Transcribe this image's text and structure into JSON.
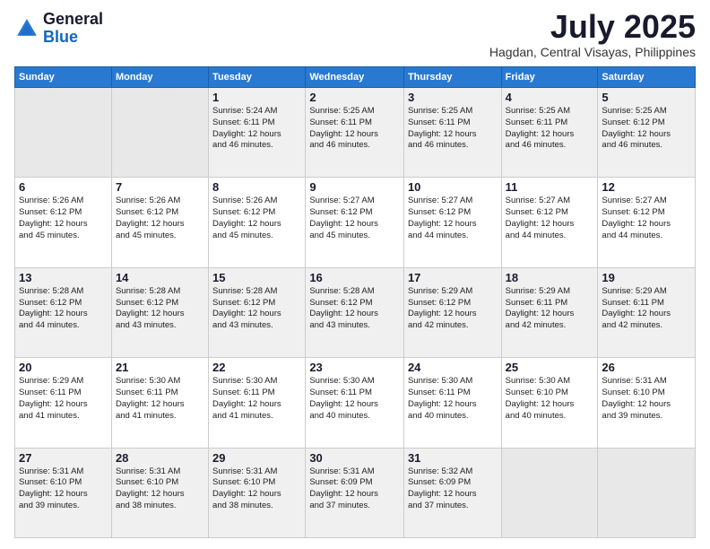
{
  "header": {
    "logo_general": "General",
    "logo_blue": "Blue",
    "month_title": "July 2025",
    "location": "Hagdan, Central Visayas, Philippines"
  },
  "days_of_week": [
    "Sunday",
    "Monday",
    "Tuesday",
    "Wednesday",
    "Thursday",
    "Friday",
    "Saturday"
  ],
  "weeks": [
    [
      {
        "day": "",
        "detail": ""
      },
      {
        "day": "",
        "detail": ""
      },
      {
        "day": "1",
        "detail": "Sunrise: 5:24 AM\nSunset: 6:11 PM\nDaylight: 12 hours\nand 46 minutes."
      },
      {
        "day": "2",
        "detail": "Sunrise: 5:25 AM\nSunset: 6:11 PM\nDaylight: 12 hours\nand 46 minutes."
      },
      {
        "day": "3",
        "detail": "Sunrise: 5:25 AM\nSunset: 6:11 PM\nDaylight: 12 hours\nand 46 minutes."
      },
      {
        "day": "4",
        "detail": "Sunrise: 5:25 AM\nSunset: 6:11 PM\nDaylight: 12 hours\nand 46 minutes."
      },
      {
        "day": "5",
        "detail": "Sunrise: 5:25 AM\nSunset: 6:12 PM\nDaylight: 12 hours\nand 46 minutes."
      }
    ],
    [
      {
        "day": "6",
        "detail": "Sunrise: 5:26 AM\nSunset: 6:12 PM\nDaylight: 12 hours\nand 45 minutes."
      },
      {
        "day": "7",
        "detail": "Sunrise: 5:26 AM\nSunset: 6:12 PM\nDaylight: 12 hours\nand 45 minutes."
      },
      {
        "day": "8",
        "detail": "Sunrise: 5:26 AM\nSunset: 6:12 PM\nDaylight: 12 hours\nand 45 minutes."
      },
      {
        "day": "9",
        "detail": "Sunrise: 5:27 AM\nSunset: 6:12 PM\nDaylight: 12 hours\nand 45 minutes."
      },
      {
        "day": "10",
        "detail": "Sunrise: 5:27 AM\nSunset: 6:12 PM\nDaylight: 12 hours\nand 44 minutes."
      },
      {
        "day": "11",
        "detail": "Sunrise: 5:27 AM\nSunset: 6:12 PM\nDaylight: 12 hours\nand 44 minutes."
      },
      {
        "day": "12",
        "detail": "Sunrise: 5:27 AM\nSunset: 6:12 PM\nDaylight: 12 hours\nand 44 minutes."
      }
    ],
    [
      {
        "day": "13",
        "detail": "Sunrise: 5:28 AM\nSunset: 6:12 PM\nDaylight: 12 hours\nand 44 minutes."
      },
      {
        "day": "14",
        "detail": "Sunrise: 5:28 AM\nSunset: 6:12 PM\nDaylight: 12 hours\nand 43 minutes."
      },
      {
        "day": "15",
        "detail": "Sunrise: 5:28 AM\nSunset: 6:12 PM\nDaylight: 12 hours\nand 43 minutes."
      },
      {
        "day": "16",
        "detail": "Sunrise: 5:28 AM\nSunset: 6:12 PM\nDaylight: 12 hours\nand 43 minutes."
      },
      {
        "day": "17",
        "detail": "Sunrise: 5:29 AM\nSunset: 6:12 PM\nDaylight: 12 hours\nand 42 minutes."
      },
      {
        "day": "18",
        "detail": "Sunrise: 5:29 AM\nSunset: 6:11 PM\nDaylight: 12 hours\nand 42 minutes."
      },
      {
        "day": "19",
        "detail": "Sunrise: 5:29 AM\nSunset: 6:11 PM\nDaylight: 12 hours\nand 42 minutes."
      }
    ],
    [
      {
        "day": "20",
        "detail": "Sunrise: 5:29 AM\nSunset: 6:11 PM\nDaylight: 12 hours\nand 41 minutes."
      },
      {
        "day": "21",
        "detail": "Sunrise: 5:30 AM\nSunset: 6:11 PM\nDaylight: 12 hours\nand 41 minutes."
      },
      {
        "day": "22",
        "detail": "Sunrise: 5:30 AM\nSunset: 6:11 PM\nDaylight: 12 hours\nand 41 minutes."
      },
      {
        "day": "23",
        "detail": "Sunrise: 5:30 AM\nSunset: 6:11 PM\nDaylight: 12 hours\nand 40 minutes."
      },
      {
        "day": "24",
        "detail": "Sunrise: 5:30 AM\nSunset: 6:11 PM\nDaylight: 12 hours\nand 40 minutes."
      },
      {
        "day": "25",
        "detail": "Sunrise: 5:30 AM\nSunset: 6:10 PM\nDaylight: 12 hours\nand 40 minutes."
      },
      {
        "day": "26",
        "detail": "Sunrise: 5:31 AM\nSunset: 6:10 PM\nDaylight: 12 hours\nand 39 minutes."
      }
    ],
    [
      {
        "day": "27",
        "detail": "Sunrise: 5:31 AM\nSunset: 6:10 PM\nDaylight: 12 hours\nand 39 minutes."
      },
      {
        "day": "28",
        "detail": "Sunrise: 5:31 AM\nSunset: 6:10 PM\nDaylight: 12 hours\nand 38 minutes."
      },
      {
        "day": "29",
        "detail": "Sunrise: 5:31 AM\nSunset: 6:10 PM\nDaylight: 12 hours\nand 38 minutes."
      },
      {
        "day": "30",
        "detail": "Sunrise: 5:31 AM\nSunset: 6:09 PM\nDaylight: 12 hours\nand 37 minutes."
      },
      {
        "day": "31",
        "detail": "Sunrise: 5:32 AM\nSunset: 6:09 PM\nDaylight: 12 hours\nand 37 minutes."
      },
      {
        "day": "",
        "detail": ""
      },
      {
        "day": "",
        "detail": ""
      }
    ]
  ]
}
